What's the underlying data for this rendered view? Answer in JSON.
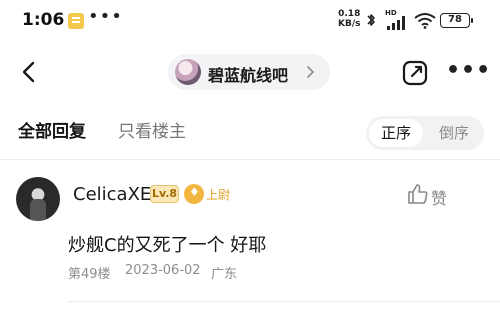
{
  "status_bar": {
    "time": "1:06",
    "dots": "•••",
    "net_speed_value": "0.18",
    "net_speed_unit": "KB/s",
    "hd_label": "HD",
    "battery": "78"
  },
  "nav": {
    "forum_name": "碧蓝航线吧"
  },
  "tabs": {
    "all_replies": "全部回复",
    "only_op": "只看楼主",
    "sort_asc": "正序",
    "sort_desc": "倒序"
  },
  "post": {
    "username": "CelicaXE",
    "level": "Lv.8",
    "badge": "上尉",
    "like_label": "赞",
    "content": "炒舰C的又死了一个 好耶",
    "floor": "第49楼",
    "date": "2023-06-02",
    "location": "广东"
  },
  "colors": {
    "accent_gold": "#e0a020",
    "muted_text": "#8d8d8d",
    "pill_bg": "#f3f3f6"
  }
}
